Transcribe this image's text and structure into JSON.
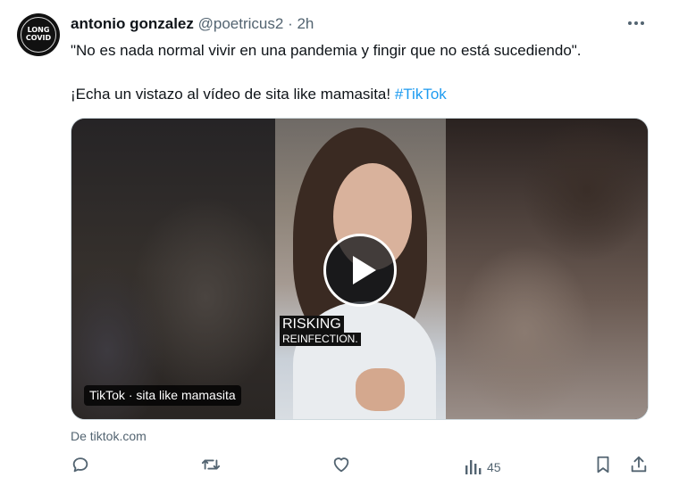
{
  "tweet": {
    "avatar_text": [
      "LONG",
      "COVID"
    ],
    "author_name": "antonio gonzalez",
    "author_handle": "@poetricus2",
    "separator": "·",
    "time": "2h",
    "line1": "\"No es nada normal vivir en una pandemia y fingir que no está sucediendo\".",
    "line2_text": "¡Echa un vistazo al vídeo de sita like mamasita! ",
    "hashtag": "#TikTok",
    "media": {
      "caption_line1": "RISKING",
      "caption_line2": "REINFECTION.",
      "label": "TikTok · sita like mamasita"
    },
    "source": "De tiktok.com",
    "actions": {
      "views_count": "45"
    }
  },
  "icons": {
    "more": "more-dots-icon",
    "reply": "reply-icon",
    "retweet": "retweet-icon",
    "like": "heart-icon",
    "views": "views-icon",
    "bookmark": "bookmark-icon",
    "share": "share-icon",
    "play": "play-icon"
  }
}
